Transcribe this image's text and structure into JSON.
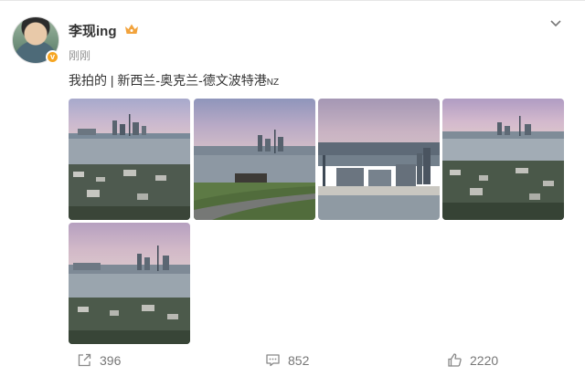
{
  "post": {
    "username": "李现ing",
    "time": "刚刚",
    "text_main": "我拍的 | 新西兰-奥克兰-德文波特港",
    "text_suffix": "NZ",
    "photo_count": 5
  },
  "actions": {
    "share_count": "396",
    "comment_count": "852",
    "like_count": "2220"
  },
  "icons": {
    "verified": "verified-badge-icon",
    "crown": "crown-icon",
    "more": "chevron-down-icon",
    "share": "share-icon",
    "comment": "comment-icon",
    "like": "thumbs-up-icon"
  },
  "colors": {
    "verified": "#f6a623",
    "crown": "#f2a33c",
    "secondary_text": "#939393"
  }
}
